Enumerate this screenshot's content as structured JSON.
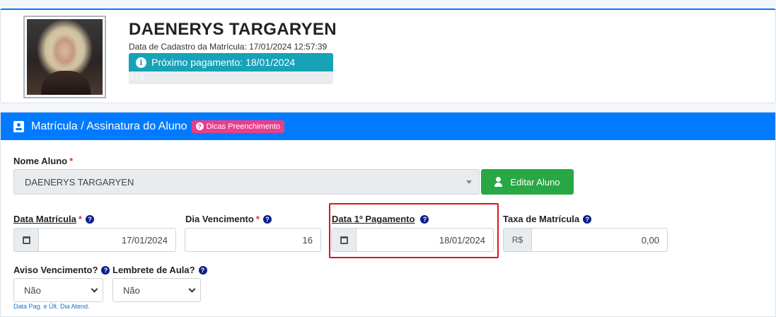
{
  "profile": {
    "name": "DAENERYS TARGARYEN",
    "registration_date": "Data de Cadastro da Matrícula: 17/01/2024 12:57:39",
    "next_payment": "Próximo pagamento: 18/01/2024",
    "progress_text": "0 / 5",
    "progress_fraction": 0
  },
  "form": {
    "header_title": "Matrícula / Assinatura do Aluno",
    "tips_badge": "Dicas Preenchimento",
    "student_label": "Nome Aluno",
    "student_value": "DAENERYS TARGARYEN",
    "edit_button": "Editar Aluno",
    "registration_date_label": "Data Matrícula",
    "registration_date_value": "17/01/2024",
    "due_day_label": "Dia Vencimento",
    "due_day_value": "16",
    "first_payment_label": "Data 1º Pagamento",
    "first_payment_value": "18/01/2024",
    "fee_label": "Taxa de Matrícula",
    "fee_prefix": "R$",
    "fee_value": "0,00",
    "due_notice_label": "Aviso Vencimento?",
    "due_notice_value": "Não",
    "class_reminder_label": "Lembrete de Aula?",
    "class_reminder_value": "Não",
    "hint_text": "Data Pag. e Últ. Dia Atend."
  },
  "colors": {
    "primary": "#007bff",
    "info": "#17a2b8",
    "success": "#28a745",
    "pink": "#e83e8c",
    "highlight": "#d9161c"
  },
  "icons": [
    "info-icon",
    "id-card-icon",
    "question-icon",
    "user-edit-icon",
    "calendar-icon",
    "chevron-down-icon"
  ]
}
